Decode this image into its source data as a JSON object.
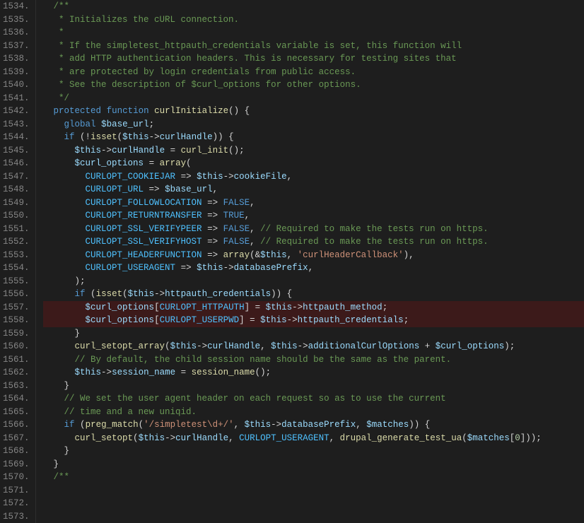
{
  "lines": [
    {
      "num": "1534.",
      "content": "  /**",
      "tokens": [
        {
          "t": "c-comment",
          "v": "  /**"
        }
      ]
    },
    {
      "num": "1535.",
      "content": "   * Initializes the cURL connection.",
      "tokens": [
        {
          "t": "c-comment",
          "v": "   * Initializes the cURL connection."
        }
      ]
    },
    {
      "num": "1536.",
      "content": "   *",
      "tokens": [
        {
          "t": "c-comment",
          "v": "   *"
        }
      ]
    },
    {
      "num": "1537.",
      "content": "   * If the simpletest_httpauth_credentials variable is set, this function will",
      "tokens": [
        {
          "t": "c-comment",
          "v": "   * If the simpletest_httpauth_credentials variable is set, this function will"
        }
      ]
    },
    {
      "num": "1538.",
      "content": "   * add HTTP authentication headers. This is necessary for testing sites that",
      "tokens": [
        {
          "t": "c-comment",
          "v": "   * add HTTP authentication headers. This is necessary for testing sites that"
        }
      ]
    },
    {
      "num": "1539.",
      "content": "   * are protected by login credentials from public access.",
      "tokens": [
        {
          "t": "c-comment",
          "v": "   * are protected by login credentials from public access."
        }
      ]
    },
    {
      "num": "1540.",
      "content": "   * See the description of $curl_options for other options.",
      "tokens": [
        {
          "t": "c-comment",
          "v": "   * See the description of $curl_options for other options."
        }
      ]
    },
    {
      "num": "1541.",
      "content": "   */",
      "tokens": [
        {
          "t": "c-comment",
          "v": "   */"
        }
      ]
    },
    {
      "num": "1542.",
      "content": "  protected function curlInitialize() {",
      "tokens": [
        {
          "t": "c-plain",
          "v": "  "
        },
        {
          "t": "c-keyword",
          "v": "protected"
        },
        {
          "t": "c-plain",
          "v": " "
        },
        {
          "t": "c-keyword",
          "v": "function"
        },
        {
          "t": "c-plain",
          "v": " "
        },
        {
          "t": "c-function",
          "v": "curlInitialize"
        },
        {
          "t": "c-plain",
          "v": "() {"
        }
      ]
    },
    {
      "num": "1543.",
      "content": "    global $base_url;",
      "tokens": [
        {
          "t": "c-plain",
          "v": "    "
        },
        {
          "t": "c-keyword",
          "v": "global"
        },
        {
          "t": "c-plain",
          "v": " "
        },
        {
          "t": "c-variable",
          "v": "$base_url"
        },
        {
          "t": "c-plain",
          "v": ";"
        }
      ]
    },
    {
      "num": "1544.",
      "content": "",
      "tokens": [
        {
          "t": "c-plain",
          "v": ""
        }
      ]
    },
    {
      "num": "1545.",
      "content": "    if (!isset($this->curlHandle)) {",
      "tokens": [
        {
          "t": "c-plain",
          "v": "    "
        },
        {
          "t": "c-keyword",
          "v": "if"
        },
        {
          "t": "c-plain",
          "v": " (!"
        },
        {
          "t": "c-function",
          "v": "isset"
        },
        {
          "t": "c-plain",
          "v": "("
        },
        {
          "t": "c-variable",
          "v": "$this"
        },
        {
          "t": "c-plain",
          "v": "->"
        },
        {
          "t": "c-property",
          "v": "curlHandle"
        },
        {
          "t": "c-plain",
          "v": ")) {"
        }
      ]
    },
    {
      "num": "1546.",
      "content": "      $this->curlHandle = curl_init();",
      "tokens": [
        {
          "t": "c-plain",
          "v": "      "
        },
        {
          "t": "c-variable",
          "v": "$this"
        },
        {
          "t": "c-plain",
          "v": "->"
        },
        {
          "t": "c-property",
          "v": "curlHandle"
        },
        {
          "t": "c-plain",
          "v": " = "
        },
        {
          "t": "c-function",
          "v": "curl_init"
        },
        {
          "t": "c-plain",
          "v": "();"
        }
      ]
    },
    {
      "num": "1547.",
      "content": "      $curl_options = array(",
      "tokens": [
        {
          "t": "c-plain",
          "v": "      "
        },
        {
          "t": "c-variable",
          "v": "$curl_options"
        },
        {
          "t": "c-plain",
          "v": " = "
        },
        {
          "t": "c-function",
          "v": "array"
        },
        {
          "t": "c-plain",
          "v": "("
        }
      ]
    },
    {
      "num": "1548.",
      "content": "        CURLOPT_COOKIEJAR => $this->cookieFile,",
      "tokens": [
        {
          "t": "c-plain",
          "v": "        "
        },
        {
          "t": "c-constant",
          "v": "CURLOPT_COOKIEJAR"
        },
        {
          "t": "c-plain",
          "v": " => "
        },
        {
          "t": "c-variable",
          "v": "$this"
        },
        {
          "t": "c-plain",
          "v": "->"
        },
        {
          "t": "c-property",
          "v": "cookieFile"
        },
        {
          "t": "c-plain",
          "v": ","
        }
      ]
    },
    {
      "num": "1549.",
      "content": "        CURLOPT_URL => $base_url,",
      "tokens": [
        {
          "t": "c-plain",
          "v": "        "
        },
        {
          "t": "c-constant",
          "v": "CURLOPT_URL"
        },
        {
          "t": "c-plain",
          "v": " => "
        },
        {
          "t": "c-variable",
          "v": "$base_url"
        },
        {
          "t": "c-plain",
          "v": ","
        }
      ]
    },
    {
      "num": "1550.",
      "content": "        CURLOPT_FOLLOWLOCATION => FALSE,",
      "tokens": [
        {
          "t": "c-plain",
          "v": "        "
        },
        {
          "t": "c-constant",
          "v": "CURLOPT_FOLLOWLOCATION"
        },
        {
          "t": "c-plain",
          "v": " => "
        },
        {
          "t": "c-keyword",
          "v": "FALSE"
        },
        {
          "t": "c-plain",
          "v": ","
        }
      ]
    },
    {
      "num": "1551.",
      "content": "        CURLOPT_RETURNTRANSFER => TRUE,",
      "tokens": [
        {
          "t": "c-plain",
          "v": "        "
        },
        {
          "t": "c-constant",
          "v": "CURLOPT_RETURNTRANSFER"
        },
        {
          "t": "c-plain",
          "v": " => "
        },
        {
          "t": "c-keyword",
          "v": "TRUE"
        },
        {
          "t": "c-plain",
          "v": ","
        }
      ]
    },
    {
      "num": "1552.",
      "content": "        CURLOPT_SSL_VERIFYPEER => FALSE, // Required to make the tests run on https.",
      "tokens": [
        {
          "t": "c-plain",
          "v": "        "
        },
        {
          "t": "c-constant",
          "v": "CURLOPT_SSL_VERIFYPEER"
        },
        {
          "t": "c-plain",
          "v": " => "
        },
        {
          "t": "c-keyword",
          "v": "FALSE"
        },
        {
          "t": "c-plain",
          "v": ", "
        },
        {
          "t": "c-comment",
          "v": "// Required to make the tests run on https."
        }
      ]
    },
    {
      "num": "1553.",
      "content": "        CURLOPT_SSL_VERIFYHOST => FALSE, // Required to make the tests run on https.",
      "tokens": [
        {
          "t": "c-plain",
          "v": "        "
        },
        {
          "t": "c-constant",
          "v": "CURLOPT_SSL_VERIFYHOST"
        },
        {
          "t": "c-plain",
          "v": " => "
        },
        {
          "t": "c-keyword",
          "v": "FALSE"
        },
        {
          "t": "c-plain",
          "v": ", "
        },
        {
          "t": "c-comment",
          "v": "// Required to make the tests run on https."
        }
      ]
    },
    {
      "num": "1554.",
      "content": "        CURLOPT_HEADERFUNCTION => array(&$this, 'curlHeaderCallback'),",
      "tokens": [
        {
          "t": "c-plain",
          "v": "        "
        },
        {
          "t": "c-constant",
          "v": "CURLOPT_HEADERFUNCTION"
        },
        {
          "t": "c-plain",
          "v": " => "
        },
        {
          "t": "c-function",
          "v": "array"
        },
        {
          "t": "c-plain",
          "v": "(&"
        },
        {
          "t": "c-variable",
          "v": "$this"
        },
        {
          "t": "c-plain",
          "v": ", "
        },
        {
          "t": "c-string",
          "v": "'curlHeaderCallback'"
        },
        {
          "t": "c-plain",
          "v": "),"
        }
      ]
    },
    {
      "num": "1555.",
      "content": "        CURLOPT_USERAGENT => $this->databasePrefix,",
      "tokens": [
        {
          "t": "c-plain",
          "v": "        "
        },
        {
          "t": "c-constant",
          "v": "CURLOPT_USERAGENT"
        },
        {
          "t": "c-plain",
          "v": " => "
        },
        {
          "t": "c-variable",
          "v": "$this"
        },
        {
          "t": "c-plain",
          "v": "->"
        },
        {
          "t": "c-property",
          "v": "databasePrefix"
        },
        {
          "t": "c-plain",
          "v": ","
        }
      ]
    },
    {
      "num": "1556.",
      "content": "      );",
      "tokens": [
        {
          "t": "c-plain",
          "v": "      );"
        }
      ]
    },
    {
      "num": "1557.",
      "content": "      if (isset($this->httpauth_credentials)) {",
      "tokens": [
        {
          "t": "c-plain",
          "v": "      "
        },
        {
          "t": "c-keyword",
          "v": "if"
        },
        {
          "t": "c-plain",
          "v": " ("
        },
        {
          "t": "c-function",
          "v": "isset"
        },
        {
          "t": "c-plain",
          "v": "("
        },
        {
          "t": "c-variable",
          "v": "$this"
        },
        {
          "t": "c-plain",
          "v": "->"
        },
        {
          "t": "c-property",
          "v": "httpauth_credentials"
        },
        {
          "t": "c-plain",
          "v": ")) {"
        }
      ]
    },
    {
      "num": "1558.",
      "content": "        $curl_options[CURLOPT_HTTPAUTH] = $this->httpauth_method;",
      "tokens": [
        {
          "t": "c-plain",
          "v": "        "
        },
        {
          "t": "c-variable",
          "v": "$curl_options"
        },
        {
          "t": "c-plain",
          "v": "["
        },
        {
          "t": "c-constant",
          "v": "CURLOPT_HTTPAUTH"
        },
        {
          "t": "c-plain",
          "v": "] = "
        },
        {
          "t": "c-variable",
          "v": "$this"
        },
        {
          "t": "c-plain",
          "v": "->"
        },
        {
          "t": "c-property",
          "v": "httpauth_method"
        },
        {
          "t": "c-plain",
          "v": ";"
        }
      ],
      "redBg": true
    },
    {
      "num": "1559.",
      "content": "        $curl_options[CURLOPT_USERPWD] = $this->httpauth_credentials;",
      "tokens": [
        {
          "t": "c-plain",
          "v": "        "
        },
        {
          "t": "c-variable",
          "v": "$curl_options"
        },
        {
          "t": "c-plain",
          "v": "["
        },
        {
          "t": "c-constant",
          "v": "CURLOPT_USERPWD"
        },
        {
          "t": "c-plain",
          "v": "] = "
        },
        {
          "t": "c-variable",
          "v": "$this"
        },
        {
          "t": "c-plain",
          "v": "->"
        },
        {
          "t": "c-property",
          "v": "httpauth_credentials"
        },
        {
          "t": "c-plain",
          "v": ";"
        }
      ],
      "redBg": true
    },
    {
      "num": "1560.",
      "content": "      }",
      "tokens": [
        {
          "t": "c-plain",
          "v": "      }"
        }
      ]
    },
    {
      "num": "1561.",
      "content": "      curl_setopt_array($this->curlHandle, $this->additionalCurlOptions + $curl_options);",
      "tokens": [
        {
          "t": "c-plain",
          "v": "      "
        },
        {
          "t": "c-function",
          "v": "curl_setopt_array"
        },
        {
          "t": "c-plain",
          "v": "("
        },
        {
          "t": "c-variable",
          "v": "$this"
        },
        {
          "t": "c-plain",
          "v": "->"
        },
        {
          "t": "c-property",
          "v": "curlHandle"
        },
        {
          "t": "c-plain",
          "v": ", "
        },
        {
          "t": "c-variable",
          "v": "$this"
        },
        {
          "t": "c-plain",
          "v": "->"
        },
        {
          "t": "c-property",
          "v": "additionalCurlOptions"
        },
        {
          "t": "c-plain",
          "v": " + "
        },
        {
          "t": "c-variable",
          "v": "$curl_options"
        },
        {
          "t": "c-plain",
          "v": ");"
        }
      ]
    },
    {
      "num": "1562.",
      "content": "",
      "tokens": [
        {
          "t": "c-plain",
          "v": ""
        }
      ]
    },
    {
      "num": "1563.",
      "content": "      // By default, the child session name should be the same as the parent.",
      "tokens": [
        {
          "t": "c-comment",
          "v": "      // By default, the child session name should be the same as the parent."
        }
      ]
    },
    {
      "num": "1564.",
      "content": "      $this->session_name = session_name();",
      "tokens": [
        {
          "t": "c-plain",
          "v": "      "
        },
        {
          "t": "c-variable",
          "v": "$this"
        },
        {
          "t": "c-plain",
          "v": "->"
        },
        {
          "t": "c-property",
          "v": "session_name"
        },
        {
          "t": "c-plain",
          "v": " = "
        },
        {
          "t": "c-function",
          "v": "session_name"
        },
        {
          "t": "c-plain",
          "v": "();"
        }
      ]
    },
    {
      "num": "1565.",
      "content": "    }",
      "tokens": [
        {
          "t": "c-plain",
          "v": "    }"
        }
      ]
    },
    {
      "num": "1566.",
      "content": "    // We set the user agent header on each request so as to use the current",
      "tokens": [
        {
          "t": "c-comment",
          "v": "    // We set the user agent header on each request so as to use the current"
        }
      ]
    },
    {
      "num": "1567.",
      "content": "    // time and a new uniqid.",
      "tokens": [
        {
          "t": "c-comment",
          "v": "    // time and a new uniqid."
        }
      ]
    },
    {
      "num": "1568.",
      "content": "    if (preg_match('/simpletest\\d+/', $this->databasePrefix, $matches)) {",
      "tokens": [
        {
          "t": "c-plain",
          "v": "    "
        },
        {
          "t": "c-keyword",
          "v": "if"
        },
        {
          "t": "c-plain",
          "v": " ("
        },
        {
          "t": "c-function",
          "v": "preg_match"
        },
        {
          "t": "c-plain",
          "v": "("
        },
        {
          "t": "c-string",
          "v": "'/simpletest\\d+/'"
        },
        {
          "t": "c-plain",
          "v": ", "
        },
        {
          "t": "c-variable",
          "v": "$this"
        },
        {
          "t": "c-plain",
          "v": "->"
        },
        {
          "t": "c-property",
          "v": "databasePrefix"
        },
        {
          "t": "c-plain",
          "v": ", "
        },
        {
          "t": "c-variable",
          "v": "$matches"
        },
        {
          "t": "c-plain",
          "v": ")) {"
        }
      ]
    },
    {
      "num": "1569.",
      "content": "      curl_setopt($this->curlHandle, CURLOPT_USERAGENT, drupal_generate_test_ua($matches[0]));",
      "tokens": [
        {
          "t": "c-plain",
          "v": "      "
        },
        {
          "t": "c-function",
          "v": "curl_setopt"
        },
        {
          "t": "c-plain",
          "v": "("
        },
        {
          "t": "c-variable",
          "v": "$this"
        },
        {
          "t": "c-plain",
          "v": "->"
        },
        {
          "t": "c-property",
          "v": "curlHandle"
        },
        {
          "t": "c-plain",
          "v": ", "
        },
        {
          "t": "c-constant",
          "v": "CURLOPT_USERAGENT"
        },
        {
          "t": "c-plain",
          "v": ", "
        },
        {
          "t": "c-function",
          "v": "drupal_generate_test_ua"
        },
        {
          "t": "c-plain",
          "v": "("
        },
        {
          "t": "c-variable",
          "v": "$matches"
        },
        {
          "t": "c-plain",
          "v": "["
        },
        {
          "t": "c-number",
          "v": "0"
        },
        {
          "t": "c-plain",
          "v": "]));"
        }
      ]
    },
    {
      "num": "1570.",
      "content": "    }",
      "tokens": [
        {
          "t": "c-plain",
          "v": "    }"
        }
      ]
    },
    {
      "num": "1571.",
      "content": "  }",
      "tokens": [
        {
          "t": "c-plain",
          "v": "  }"
        }
      ]
    },
    {
      "num": "1572.",
      "content": "",
      "tokens": [
        {
          "t": "c-plain",
          "v": ""
        }
      ]
    },
    {
      "num": "1573.",
      "content": "  /**",
      "tokens": [
        {
          "t": "c-comment",
          "v": "  /**"
        }
      ]
    }
  ]
}
